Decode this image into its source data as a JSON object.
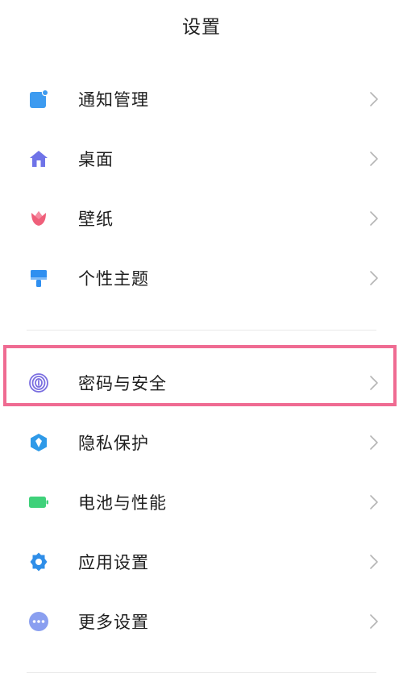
{
  "header": {
    "title": "设置"
  },
  "group_one": [
    {
      "label": "通知管理",
      "icon": "notification-icon",
      "color": "#3d9bf0"
    },
    {
      "label": "桌面",
      "icon": "home-icon",
      "color": "#6f73e8"
    },
    {
      "label": "壁纸",
      "icon": "tulip-icon",
      "color": "#ef5f7a"
    },
    {
      "label": "个性主题",
      "icon": "paint-brush-icon",
      "color": "#2f8ff0"
    }
  ],
  "group_two": [
    {
      "label": "密码与安全",
      "icon": "fingerprint-icon",
      "color": "#7a6ee0"
    },
    {
      "label": "隐私保护",
      "icon": "privacy-shield-icon",
      "color": "#2f9ae8"
    },
    {
      "label": "电池与性能",
      "icon": "battery-icon",
      "color": "#3fd17a"
    },
    {
      "label": "应用设置",
      "icon": "gear-icon",
      "color": "#2f8ee8"
    },
    {
      "label": "更多设置",
      "icon": "more-icon",
      "color": "#8a9ff0"
    }
  ],
  "highlight": {
    "color": "#ef6b92",
    "target": "密码与安全"
  }
}
